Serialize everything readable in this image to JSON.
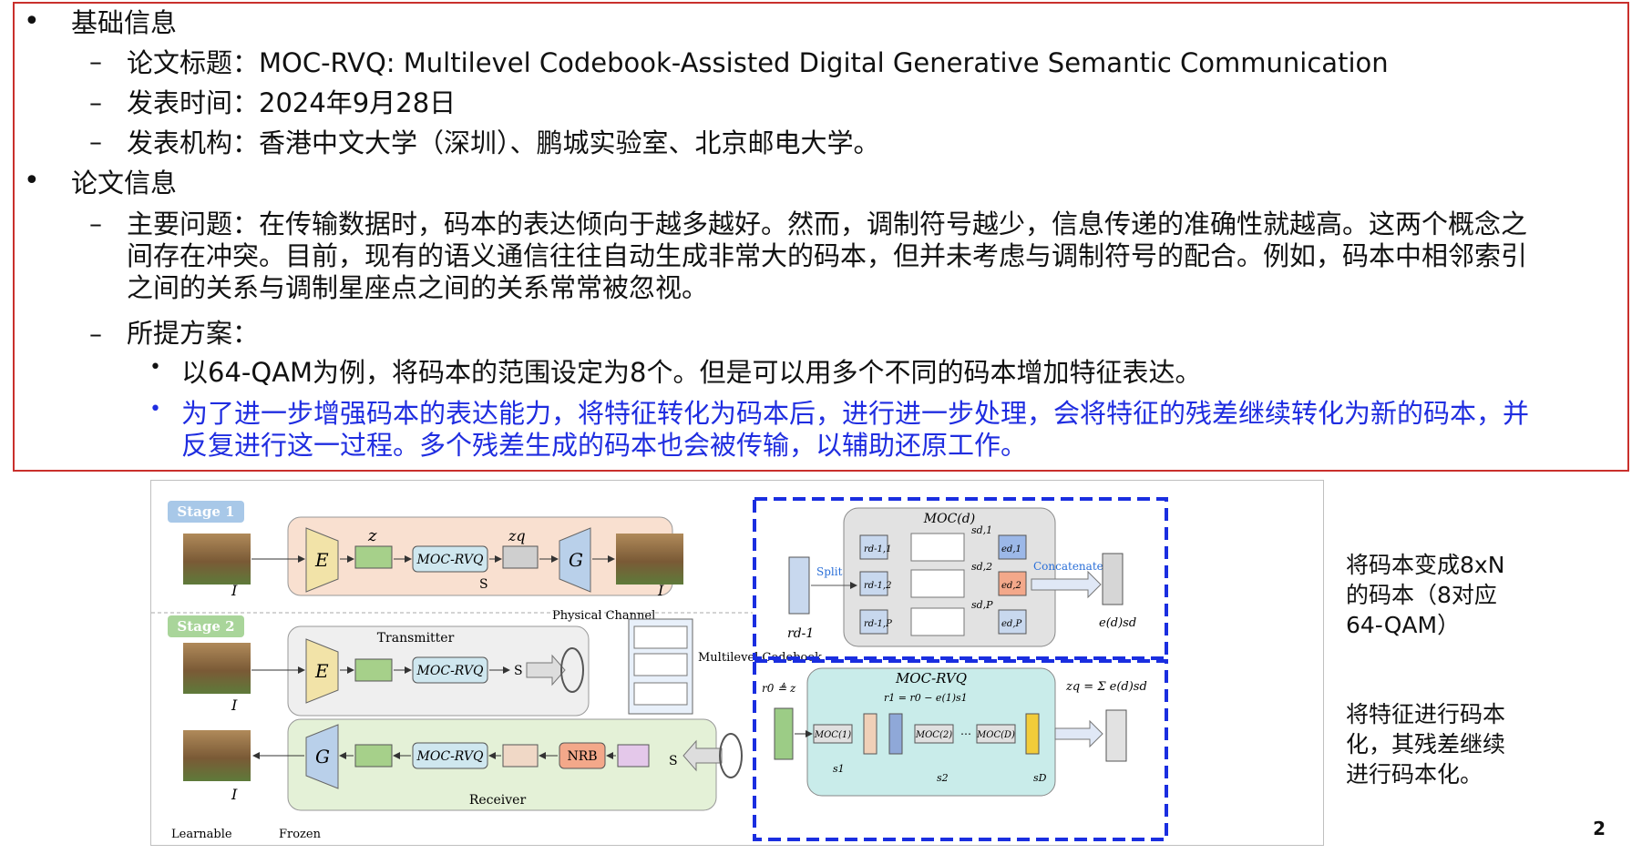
{
  "section1": {
    "heading": "基础信息",
    "items": [
      "论文标题：MOC-RVQ: Multilevel Codebook-Assisted Digital Generative Semantic Communication",
      "发表时间：2024年9月28日",
      "发表机构：香港中文大学（深圳）、鹏城实验室、北京邮电大学。"
    ]
  },
  "section2": {
    "heading": "论文信息",
    "problem_lines": [
      "主要问题：在传输数据时，码本的表达倾向于越多越好。然而，调制符号越少，信息传递的准确性就越高。这两个概念之",
      "间存在冲突。目前，现有的语义通信往往自动生成非常大的码本，但并未考虑与调制符号的配合。例如，码本中相邻索引",
      "之间的关系与调制星座点之间的关系常常被忽视。"
    ],
    "solution_label": "所提方案：",
    "sub1": "以64-QAM为例，将码本的范围设定为8个。但是可以用多个不同的码本增加特征表达。",
    "sub2_lines": [
      "为了进一步增强码本的表达能力，将特征转化为码本后，进行进一步处理，会将特征的残差继续转化为新的码本，并",
      "反复进行这一过程。多个残差生成的码本也会被传输，以辅助还原工作。"
    ]
  },
  "figure": {
    "stage1": "Stage 1",
    "stage2": "Stage 2",
    "E": "E",
    "G": "G",
    "moc_rvq": "MOC-RVQ",
    "nrb": "NRB",
    "z": "z",
    "zq": "zq",
    "s": "S",
    "I": "I",
    "transmitter": "Transmitter",
    "receiver": "Receiver",
    "physical_channel": "Physical Channel",
    "multilevel_codebook": "Multilevel Codebook",
    "learnable": "Learnable",
    "frozen": "Frozen",
    "split": "Split",
    "concatenate": "Concatenate",
    "moc_d": "MOC(d)",
    "moc_rvq_title": "MOC-RVQ",
    "r_prev": "rd-1",
    "r_items": [
      "rd-1,1",
      "rd-1,2",
      "rd-1,P"
    ],
    "s_items": [
      "sd,1",
      "sd,2",
      "sd,P"
    ],
    "e_items": [
      "ed,1",
      "ed,2",
      "ed,P"
    ],
    "esd": "e(d)sd",
    "moc_chain": [
      "MOC(1)",
      "MOC(2)",
      "MOC(D)"
    ],
    "chain_s": [
      "s1",
      "s2",
      "sD"
    ],
    "r0_eq": "r0 ≜ z",
    "r1_eq": "r1 = r0 − e(1)s1",
    "zq_eq": "zq = Σ e(d)sd",
    "ellipsis": "⋯"
  },
  "side_note1": [
    "将码本变成8xN",
    "的码本（8对应",
    "64-QAM）"
  ],
  "side_note2": [
    "将特征进行码本",
    "化，其残差继续",
    "进行码本化。"
  ],
  "page_number": "2"
}
